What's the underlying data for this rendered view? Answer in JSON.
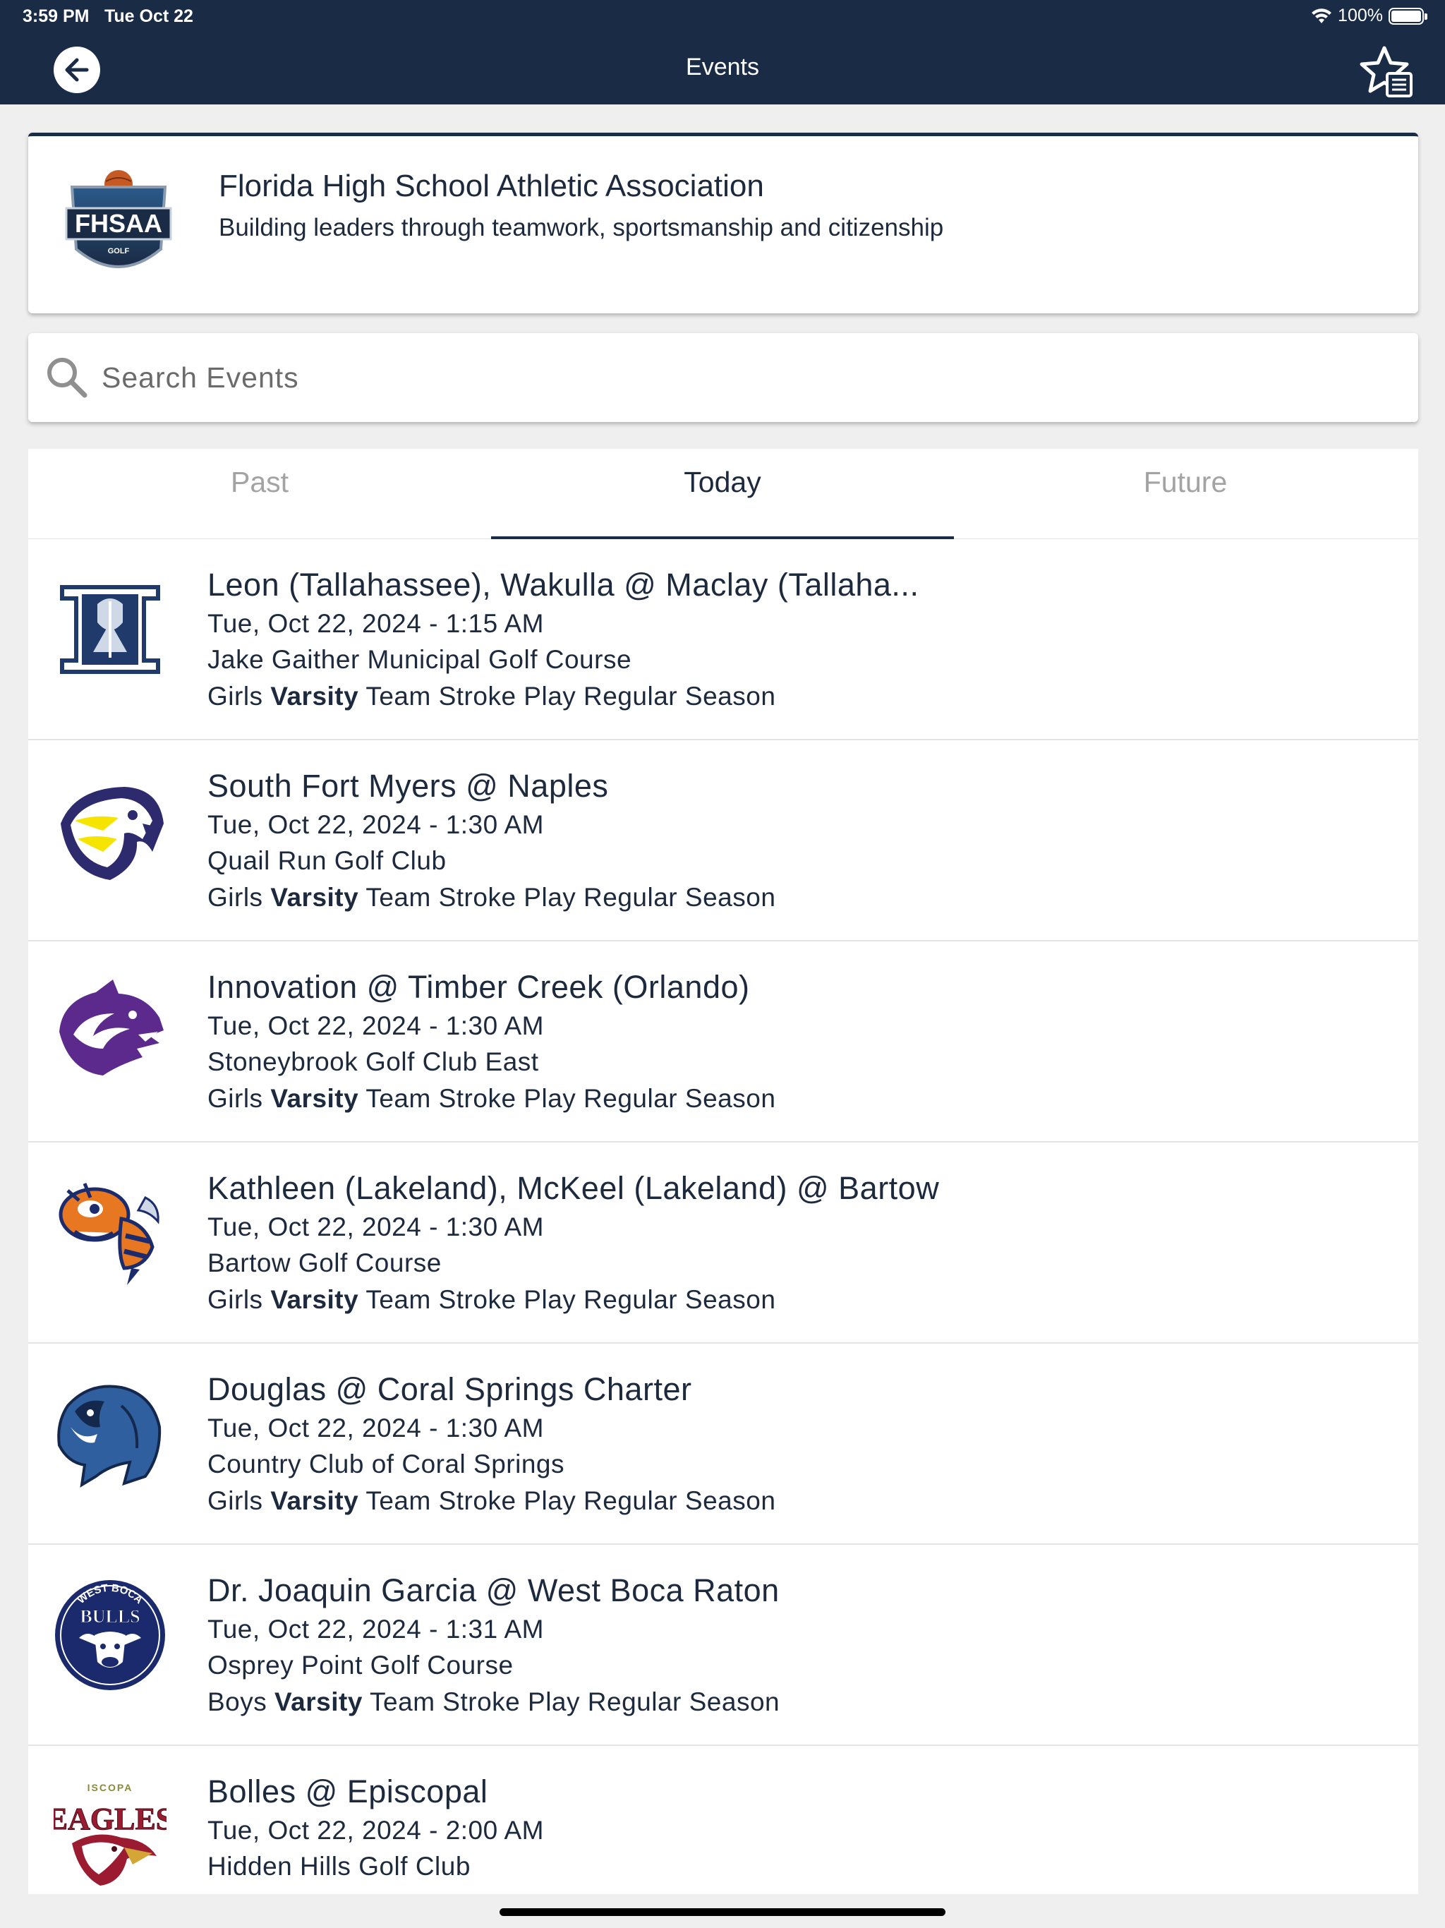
{
  "status_bar": {
    "time": "3:59 PM",
    "date": "Tue Oct 22",
    "battery": "100%",
    "battery_level": 1.0
  },
  "nav": {
    "title": "Events"
  },
  "org": {
    "name": "Florida High School Athletic Association",
    "tagline": "Building leaders through teamwork, sportsmanship and citizenship",
    "logo_text": "FHSAA",
    "logo_subtext": "GOLF"
  },
  "search": {
    "placeholder": "Search Events",
    "value": ""
  },
  "tabs": [
    {
      "label": "Past",
      "active": false
    },
    {
      "label": "Today",
      "active": true
    },
    {
      "label": "Future",
      "active": false
    }
  ],
  "events": [
    {
      "title": "Leon (Tallahassee), Wakulla @ Maclay (Tallaha...",
      "datetime": "Tue, Oct 22, 2024 - 1:15 AM",
      "venue": "Jake Gaither Municipal Golf Course",
      "gender": "Girls",
      "level": "Varsity",
      "category": "Team Stroke Play Regular Season",
      "logo": "maclay-marauder-logo",
      "logo_color": "#1f3a6b"
    },
    {
      "title": "South Fort Myers @ Naples",
      "datetime": "Tue, Oct 22, 2024 - 1:30 AM",
      "venue": "Quail Run Golf Club",
      "gender": "Girls",
      "level": "Varsity",
      "category": "Team Stroke Play Regular Season",
      "logo": "eagle-logo",
      "logo_color": "#2d2b6e"
    },
    {
      "title": "Innovation @ Timber Creek (Orlando)",
      "datetime": "Tue, Oct 22, 2024 - 1:30 AM",
      "venue": "Stoneybrook Golf Club East",
      "gender": "Girls",
      "level": "Varsity",
      "category": "Team Stroke Play Regular Season",
      "logo": "wolf-logo",
      "logo_color": "#5b2a8c"
    },
    {
      "title": "Kathleen (Lakeland), McKeel (Lakeland) @ Bartow",
      "datetime": "Tue, Oct 22, 2024 - 1:30 AM",
      "venue": "Bartow Golf Course",
      "gender": "Girls",
      "level": "Varsity",
      "category": "Team Stroke Play Regular Season",
      "logo": "yellowjacket-logo",
      "logo_color": "#e87722"
    },
    {
      "title": "Douglas @ Coral Springs Charter",
      "datetime": "Tue, Oct 22, 2024 - 1:30 AM",
      "venue": "Country Club of Coral Springs",
      "gender": "Girls",
      "level": "Varsity",
      "category": "Team Stroke Play Regular Season",
      "logo": "panther-logo",
      "logo_color": "#2f5f9e"
    },
    {
      "title": "Dr. Joaquin Garcia @ West Boca Raton",
      "datetime": "Tue, Oct 22, 2024 - 1:31 AM",
      "venue": "Osprey Point Golf Course",
      "gender": "Boys",
      "level": "Varsity",
      "category": "Team Stroke Play Regular Season",
      "logo": "bulls-logo",
      "logo_color": "#1a2a6c",
      "logo_text": "BULLS",
      "logo_arc": "WEST BOCA"
    },
    {
      "title": "Bolles @ Episcopal",
      "datetime": "Tue, Oct 22, 2024 - 2:00 AM",
      "venue": "Hidden Hills Golf Club",
      "gender": "",
      "level": "",
      "category": "",
      "logo": "eagles-logo",
      "logo_color": "#9b1b30",
      "logo_text": "EAGLES",
      "logo_arc": "ISCOPA"
    }
  ]
}
